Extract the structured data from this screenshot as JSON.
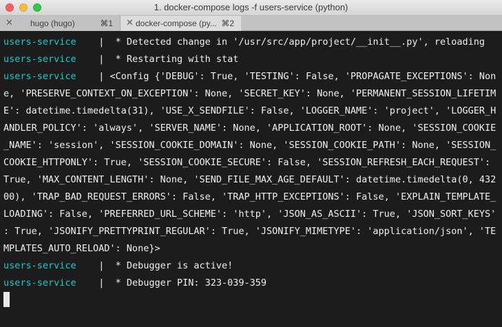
{
  "window": {
    "title": "1. docker-compose logs -f users-service (python)"
  },
  "tabs": [
    {
      "close": "✕",
      "label": "hugo (hugo)",
      "shortcut": "⌘1"
    },
    {
      "close": "✕",
      "label": "docker-compose (py...",
      "shortcut": "⌘2"
    }
  ],
  "terminal": {
    "service": "users-service",
    "pipe": "|",
    "lines": [
      " * Detected change in '/usr/src/app/project/__init__.py', reloading",
      " * Restarting with stat",
      "<Config {'DEBUG': True, 'TESTING': False, 'PROPAGATE_EXCEPTIONS': Non",
      "e, 'PRESERVE_CONTEXT_ON_EXCEPTION': None, 'SECRET_KEY': None, 'PERMANENT_SESSION_LIFETIM",
      "E': datetime.timedelta(31), 'USE_X_SENDFILE': False, 'LOGGER_NAME': 'project', 'LOGGER_H",
      "ANDLER_POLICY': 'always', 'SERVER_NAME': None, 'APPLICATION_ROOT': None, 'SESSION_COOKIE",
      "_NAME': 'session', 'SESSION_COOKIE_DOMAIN': None, 'SESSION_COOKIE_PATH': None, 'SESSION_",
      "COOKIE_HTTPONLY': True, 'SESSION_COOKIE_SECURE': False, 'SESSION_REFRESH_EACH_REQUEST':",
      "True, 'MAX_CONTENT_LENGTH': None, 'SEND_FILE_MAX_AGE_DEFAULT': datetime.timedelta(0, 432",
      "00), 'TRAP_BAD_REQUEST_ERRORS': False, 'TRAP_HTTP_EXCEPTIONS': False, 'EXPLAIN_TEMPLATE_",
      "LOADING': False, 'PREFERRED_URL_SCHEME': 'http', 'JSON_AS_ASCII': True, 'JSON_SORT_KEYS'",
      ": True, 'JSONIFY_PRETTYPRINT_REGULAR': True, 'JSONIFY_MIMETYPE': 'application/json', 'TE",
      "MPLATES_AUTO_RELOAD': None}>",
      " * Debugger is active!",
      " * Debugger PIN: 323-039-359"
    ]
  },
  "colors": {
    "background": "#1c1c1c",
    "service_name": "#1fc8c8",
    "text": "#f0f0f0"
  }
}
